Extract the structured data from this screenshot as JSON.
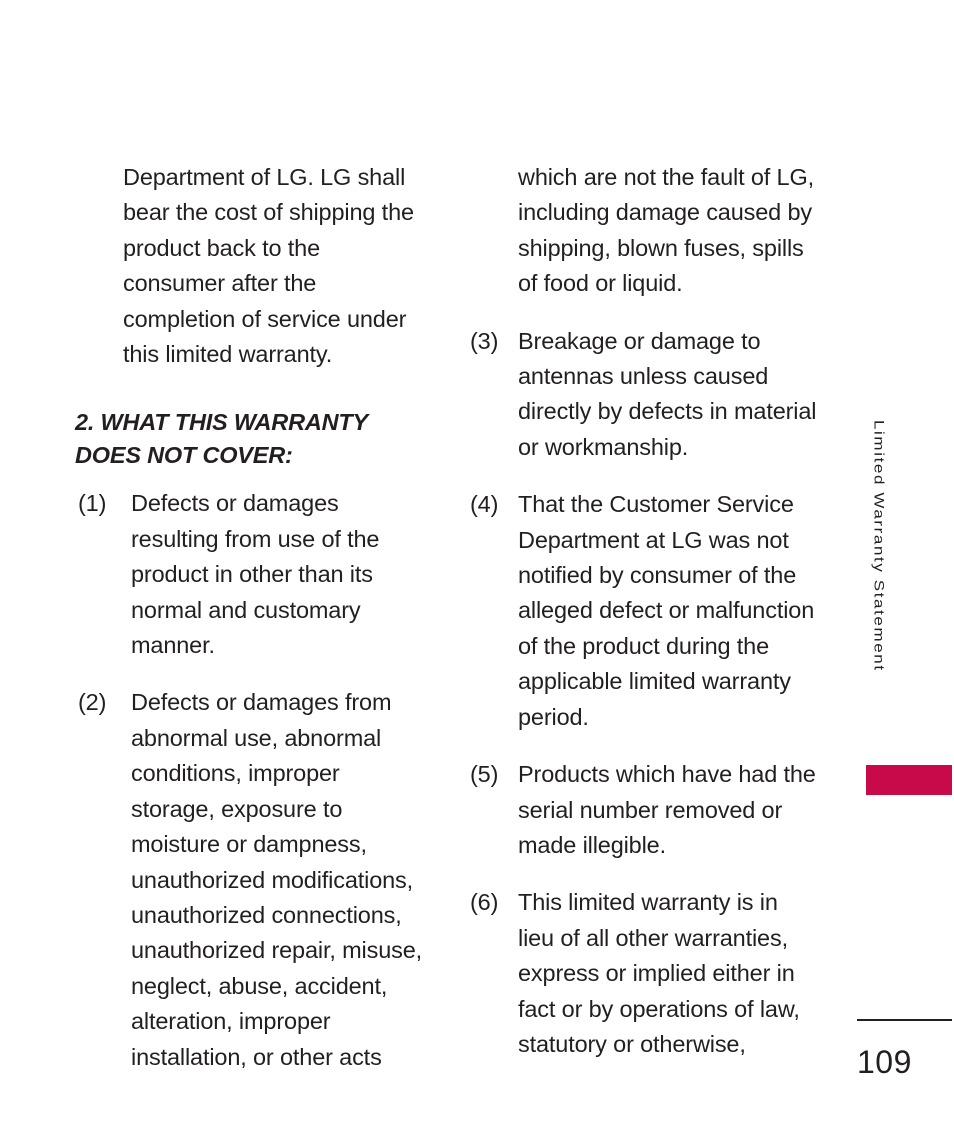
{
  "page": {
    "number": "109",
    "background_color": "#ffffff",
    "text_color": "#231f20"
  },
  "side_tab": {
    "label": "Limited Warranty Statement",
    "accent_color": "#c80a4b"
  },
  "left_column": {
    "continuation_paragraph": "Department of LG. LG shall bear the cost of shipping the product back to the consumer after the completion of service under this limited warranty.",
    "heading": "2. WHAT THIS WARRANTY DOES NOT COVER:",
    "items": [
      {
        "marker": "(1)",
        "text": "Defects or damages resulting from use of the product in other than its normal and customary manner."
      },
      {
        "marker": "(2)",
        "text": "Defects or damages from abnormal use, abnormal conditions, improper storage, exposure to moisture or dampness, unauthorized modifications, unauthorized connections, unauthorized repair, misuse, neglect, abuse, accident, alteration, improper installation, or other acts"
      }
    ]
  },
  "right_column": {
    "continuation_paragraph": "which are not the fault of LG, including damage caused by shipping, blown fuses, spills of food or liquid.",
    "items": [
      {
        "marker": "(3)",
        "text": "Breakage or damage to antennas unless caused directly by defects in material or workmanship."
      },
      {
        "marker": "(4)",
        "text": "That the Customer Service Department at LG was not notified by consumer of the alleged defect or malfunction of the product during the applicable limited warranty period."
      },
      {
        "marker": "(5)",
        "text": "Products which have had the serial number removed or made illegible."
      },
      {
        "marker": "(6)",
        "text": "This limited warranty is in lieu of all other warranties, express or implied either in fact or by operations of law, statutory or otherwise,"
      }
    ]
  }
}
